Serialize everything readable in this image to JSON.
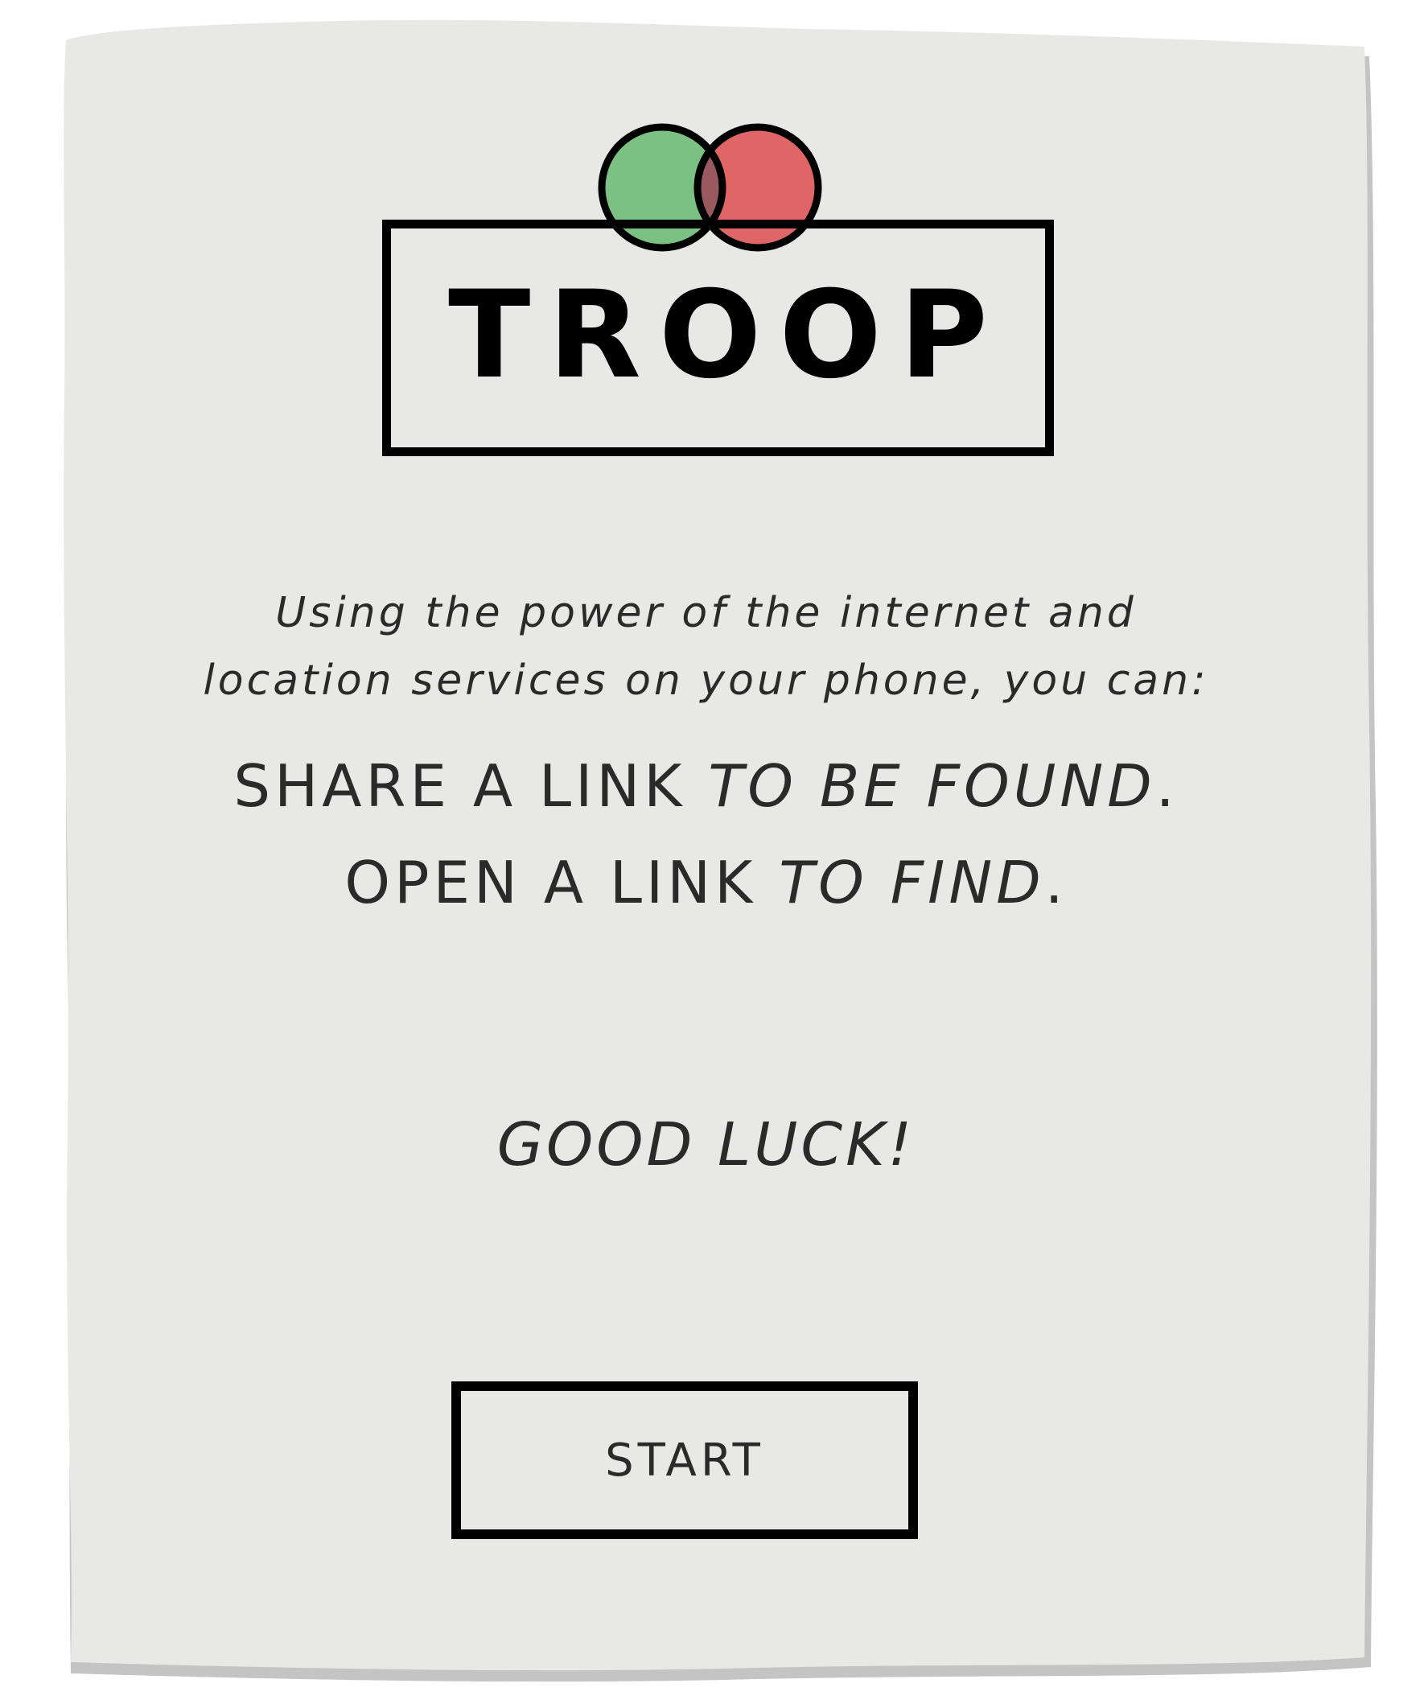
{
  "colors": {
    "paper": "#e8e8e7",
    "paper_shadow": "#c4c4c4",
    "circle_green": "#7cc184",
    "circle_red": "#e06566",
    "circle_overlap": "#99595f",
    "outline": "#000000",
    "text": "#2a2a2a"
  },
  "logo": {
    "word": "TROOP",
    "icons": [
      "green-circle-icon",
      "red-circle-icon"
    ]
  },
  "intro": {
    "line1": "Using the power of the internet and",
    "line2": "location services on your phone, you can:"
  },
  "tagline": {
    "line1": {
      "plain": "SHARE A LINK ",
      "emphasis": "TO BE FOUND",
      "end": "."
    },
    "line2": {
      "plain": "OPEN A LINK ",
      "emphasis": "TO FIND",
      "end": "."
    }
  },
  "closing": "GOOD LUCK!",
  "start_button": {
    "label": "START"
  }
}
